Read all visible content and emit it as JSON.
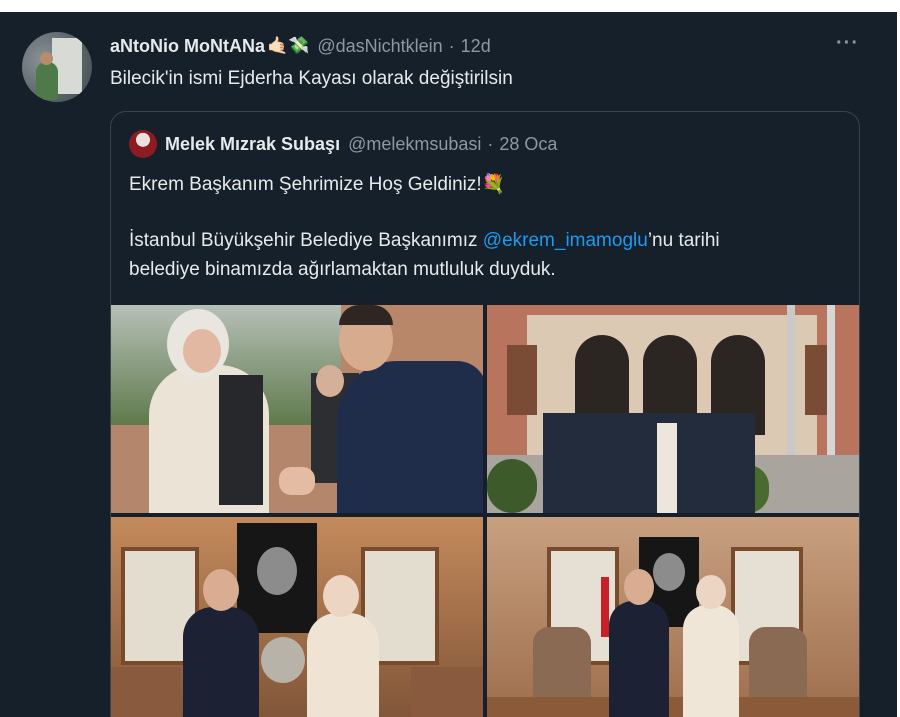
{
  "tweet": {
    "author_name": "aNtoNio MoNtANa",
    "author_emoji": "🤙🏻💸",
    "handle": "@dasNichtklein",
    "separator": "·",
    "time": "12d",
    "more": "···",
    "text": "Bilecik'in ismi Ejderha Kayası olarak değiştirilsin"
  },
  "quote": {
    "author_name": "Melek Mızrak Subaşı",
    "handle": "@melekmsubasi",
    "separator": "·",
    "time": "28 Oca",
    "line1": "Ekrem Başkanım Şehrimize Hoş Geldiniz!💐",
    "line2_before": "İstanbul Büyükşehir Belediye Başkanımız ",
    "line2_mention": "@ekrem_imamoglu",
    "line2_after": "’nu tarihi",
    "line3": "belediye binamızda ağırlamaktan mutluluk duyduk."
  },
  "colors": {
    "background": "#15202b",
    "text_primary": "#e7e9ea",
    "text_secondary": "#8b98a5",
    "mention": "#1d9bf0",
    "border": "#38444d"
  },
  "icons": {
    "more": "more-horizontal-icon"
  }
}
